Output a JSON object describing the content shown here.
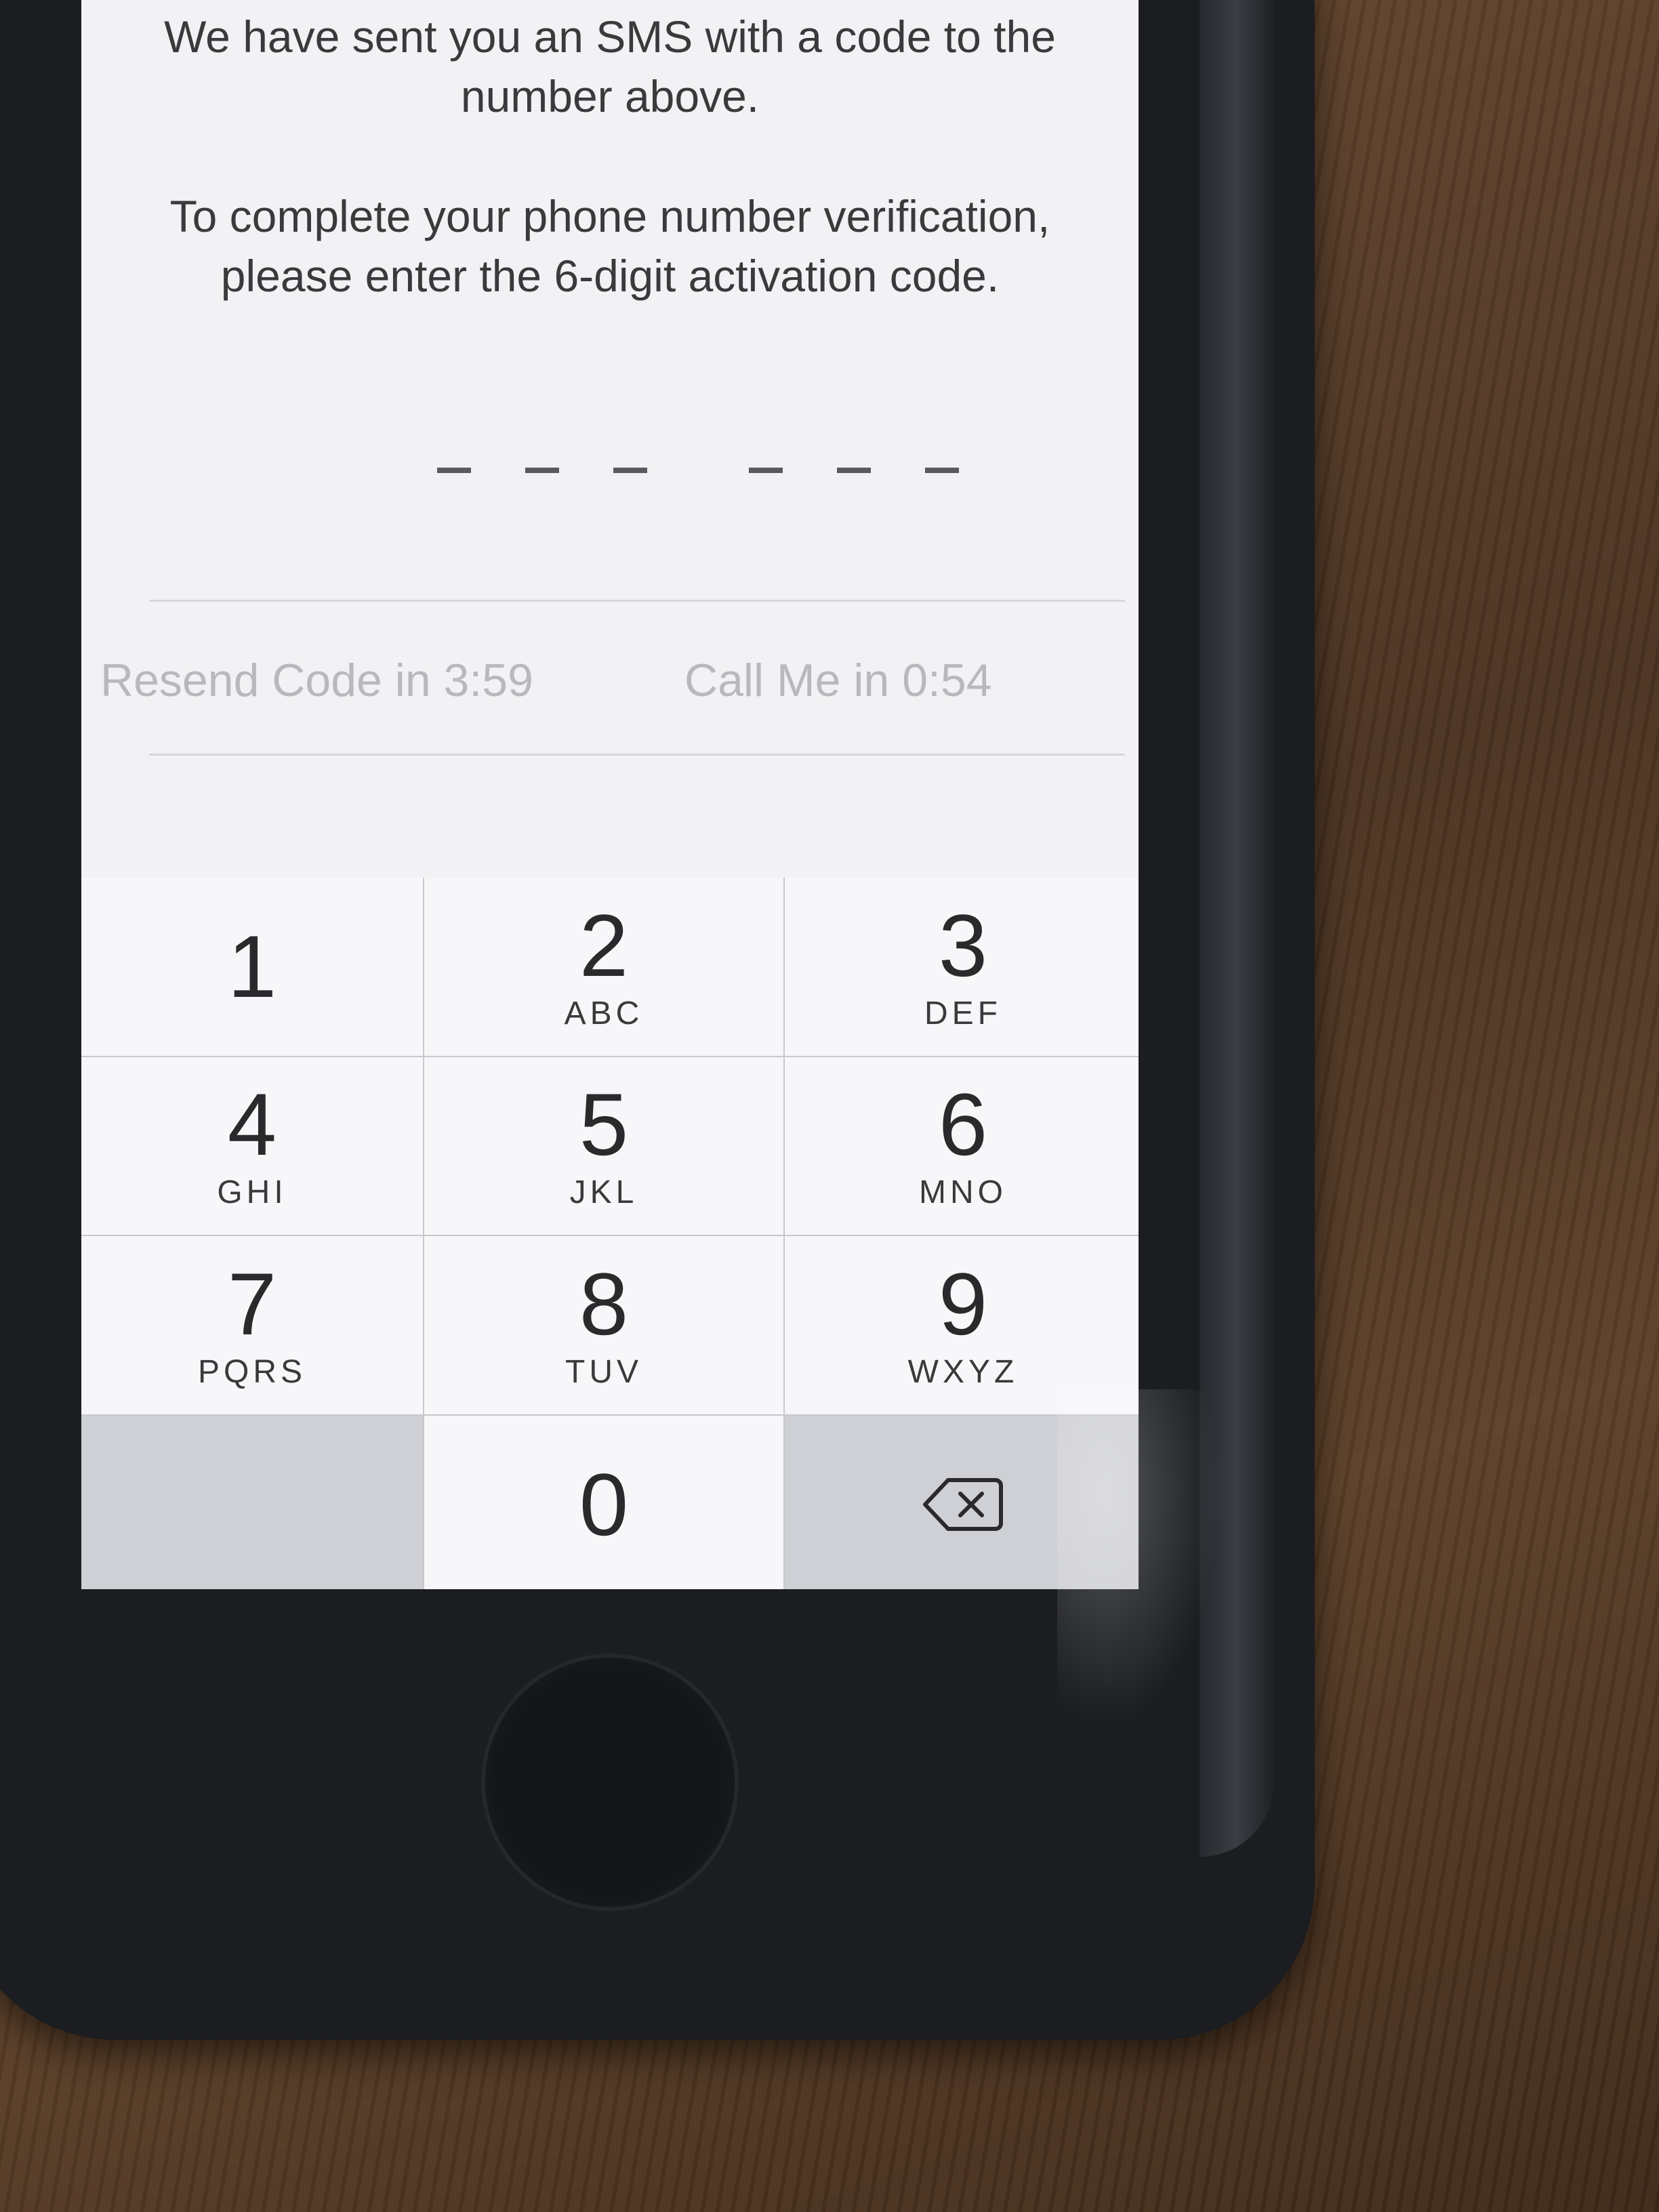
{
  "message": {
    "sent_line": "We have sent you an SMS with a code to the number above.",
    "instruction_line": "To complete your phone number verification, please enter the 6-digit activation code."
  },
  "code_entry": {
    "slot_count": 6,
    "value": ""
  },
  "timers": {
    "resend": "Resend Code in 3:59",
    "call": "Call Me in 0:54"
  },
  "keypad": {
    "keys": [
      {
        "num": "1",
        "letters": ""
      },
      {
        "num": "2",
        "letters": "ABC"
      },
      {
        "num": "3",
        "letters": "DEF"
      },
      {
        "num": "4",
        "letters": "GHI"
      },
      {
        "num": "5",
        "letters": "JKL"
      },
      {
        "num": "6",
        "letters": "MNO"
      },
      {
        "num": "7",
        "letters": "PQRS"
      },
      {
        "num": "8",
        "letters": "TUV"
      },
      {
        "num": "9",
        "letters": "WXYZ"
      },
      {
        "num": "0",
        "letters": ""
      }
    ],
    "delete_icon": "delete-backspace-icon"
  }
}
